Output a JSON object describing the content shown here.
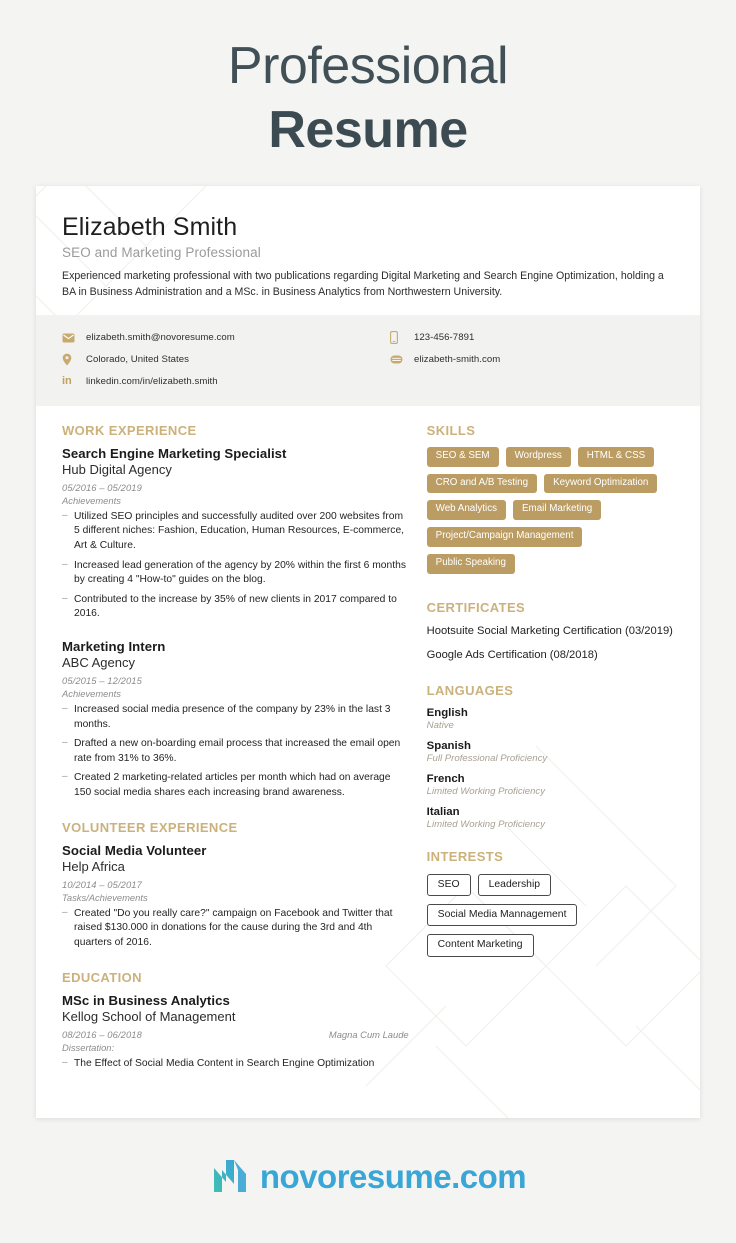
{
  "header": {
    "line1": "Professional",
    "line2": "Resume"
  },
  "profile": {
    "name": "Elizabeth Smith",
    "title": "SEO and Marketing Professional",
    "summary": "Experienced marketing professional with two publications regarding Digital Marketing and Search Engine Optimization, holding a BA in Business Administration and a MSc. in Business Analytics from Northwestern University."
  },
  "contact": {
    "left": [
      {
        "icon": "envelope-icon",
        "text": "elizabeth.smith@novoresume.com"
      },
      {
        "icon": "location-pin-icon",
        "text": "Colorado, United States"
      },
      {
        "icon": "linkedin-icon",
        "text": "linkedin.com/in/elizabeth.smith"
      }
    ],
    "right": [
      {
        "icon": "phone-icon",
        "text": "123-456-7891"
      },
      {
        "icon": "globe-icon",
        "text": "elizabeth-smith.com"
      }
    ]
  },
  "sections": {
    "work_experience": {
      "heading": "WORK EXPERIENCE",
      "entries": [
        {
          "role": "Search Engine Marketing Specialist",
          "org": "Hub Digital Agency",
          "date": "05/2016 – 05/2019",
          "sublabel": "Achievements",
          "bullets": [
            "Utilized SEO principles and successfully audited over 200 websites from 5 different niches: Fashion, Education, Human Resources, E-commerce, Art & Culture.",
            "Increased lead generation of the agency by 20% within the first 6 months by creating 4 \"How-to\" guides on the blog.",
            "Contributed to the increase by 35% of new clients in 2017 compared to 2016."
          ]
        },
        {
          "role": "Marketing Intern",
          "org": "ABC Agency",
          "date": "05/2015 – 12/2015",
          "sublabel": "Achievements",
          "bullets": [
            "Increased social media presence of the company by 23% in the last 3 months.",
            "Drafted a new on-boarding email process that increased the email open rate from 31% to 36%.",
            "Created 2 marketing-related articles per month which had on average 150 social media shares each increasing brand awareness."
          ]
        }
      ]
    },
    "volunteer_experience": {
      "heading": "VOLUNTEER EXPERIENCE",
      "entries": [
        {
          "role": "Social Media Volunteer",
          "org": "Help Africa",
          "date": "10/2014 – 05/2017",
          "sublabel": "Tasks/Achievements",
          "bullets": [
            "Created \"Do you really care?\" campaign on Facebook and Twitter that raised $130.000 in donations for the cause during the 3rd and 4th quarters of 2016."
          ]
        }
      ]
    },
    "education": {
      "heading": "EDUCATION",
      "entries": [
        {
          "role": "MSc in Business Analytics",
          "org": "Kellog School of Management",
          "date": "08/2016 – 06/2018",
          "honor": "Magna Cum Laude",
          "sublabel": "Dissertation:",
          "bullets": [
            "The Effect of Social Media Content in Search Engine Optimization"
          ]
        }
      ]
    },
    "skills": {
      "heading": "SKILLS",
      "tags": [
        "SEO & SEM",
        "Wordpress",
        "HTML & CSS",
        "CRO and A/B Testing",
        "Keyword Optimization",
        "Web Analytics",
        "Email Marketing",
        "Project/Campaign Management",
        "Public Speaking"
      ]
    },
    "certificates": {
      "heading": "CERTIFICATES",
      "items": [
        "Hootsuite Social Marketing Certification (03/2019)",
        "Google Ads Certification (08/2018)"
      ]
    },
    "languages": {
      "heading": "LANGUAGES",
      "items": [
        {
          "name": "English",
          "level": "Native"
        },
        {
          "name": "Spanish",
          "level": "Full Professional Proficiency"
        },
        {
          "name": "French",
          "level": "Limited Working Proficiency"
        },
        {
          "name": "Italian",
          "level": "Limited Working Proficiency"
        }
      ]
    },
    "interests": {
      "heading": "INTERESTS",
      "tags": [
        "SEO",
        "Leadership",
        "Social Media Mannagement",
        "Content Marketing"
      ]
    }
  },
  "footer": {
    "brand": "novoresume.com"
  },
  "colors": {
    "accent_gold": "#cbb27c",
    "tag_gold": "#bb9c63",
    "heading_dark": "#3c4a52",
    "brand_blue": "#3aa6d6",
    "brand_teal": "#3fc0b0",
    "page_bg": "#f4f4f2",
    "contact_band": "#f2f2f1"
  }
}
